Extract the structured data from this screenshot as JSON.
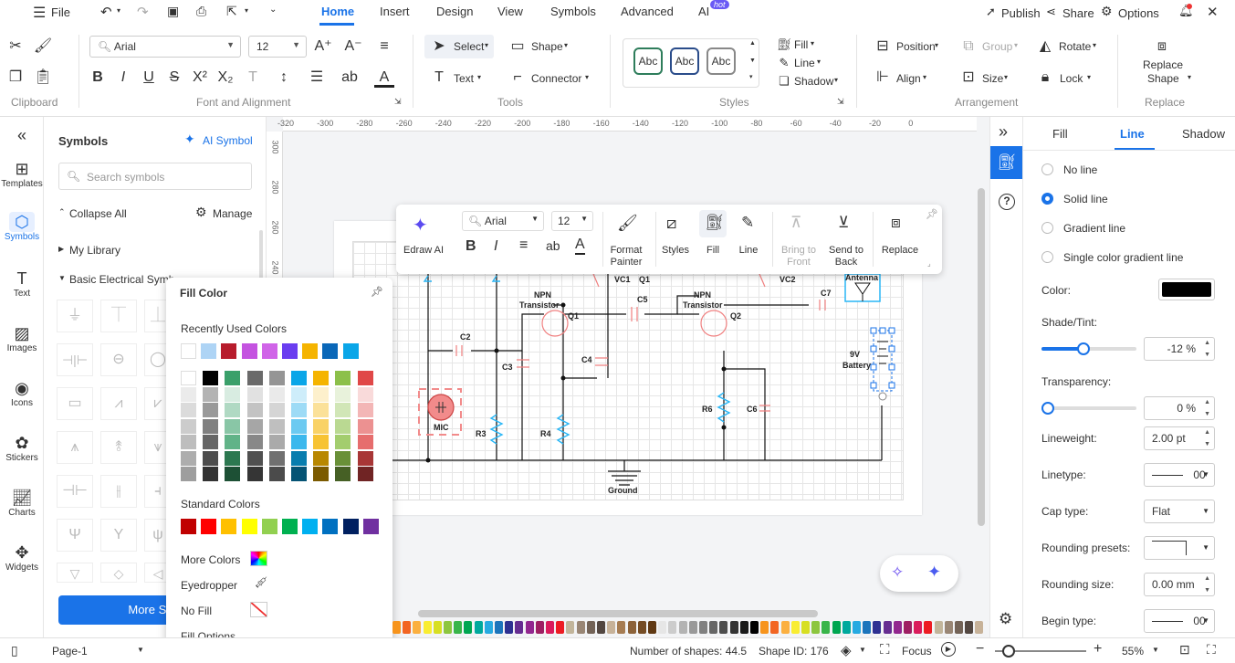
{
  "titlebar": {
    "file_label": "File",
    "tabs": [
      {
        "label": "Home",
        "active": true
      },
      {
        "label": "Insert"
      },
      {
        "label": "Design"
      },
      {
        "label": "View"
      },
      {
        "label": "Symbols"
      },
      {
        "label": "Advanced"
      },
      {
        "label": "AI",
        "badge": "hot"
      }
    ],
    "publish": "Publish",
    "share": "Share",
    "options": "Options"
  },
  "ribbon": {
    "groups": [
      "Clipboard",
      "Font and Alignment",
      "Tools",
      "Styles",
      "Arrangement",
      "Replace"
    ],
    "font_name": "Arial",
    "font_size": "12",
    "select": "Select",
    "shape": "Shape",
    "text": "Text",
    "connector": "Connector",
    "style_sample": "Abc",
    "fill": "Fill",
    "line": "Line",
    "shadow": "Shadow",
    "position": "Position",
    "group": "Group",
    "rotate": "Rotate",
    "align": "Align",
    "size": "Size",
    "lock": "Lock",
    "replace_shape": [
      "Replace",
      "Shape"
    ]
  },
  "leftrail": [
    "Templates",
    "Symbols",
    "Text",
    "Images",
    "Icons",
    "Stickers",
    "Charts",
    "Widgets"
  ],
  "symbols": {
    "title": "Symbols",
    "ai_symbol": "AI Symbol",
    "search_placeholder": "Search symbols",
    "collapse_all": "Collapse All",
    "manage": "Manage",
    "my_library": "My Library",
    "basic_electrical": "Basic Electrical Symb",
    "more_symbols": "More Sym"
  },
  "ruler": {
    "h": [
      "-320",
      "-300",
      "-280",
      "-260",
      "-240",
      "-220",
      "-200",
      "-180",
      "-160",
      "-140",
      "-120",
      "-100",
      "-80",
      "-60",
      "-40",
      "-20",
      "0"
    ],
    "v": [
      "300",
      "280",
      "260",
      "240"
    ]
  },
  "floatbar": {
    "edraw_ai": "Edraw AI",
    "font": "Arial",
    "size": "12",
    "format_painter": [
      "Format",
      "Painter"
    ],
    "styles": "Styles",
    "fill": "Fill",
    "line": "Line",
    "bring_front": [
      "Bring to",
      "Front"
    ],
    "send_back": [
      "Send to",
      "Back"
    ],
    "replace": "Replace"
  },
  "fill_color": {
    "title": "Fill Color",
    "recent_label": "Recently Used Colors",
    "recent": [
      "#ffffff",
      "#aed4f5",
      "#b71c2c",
      "#c453e0",
      "#d064e8",
      "#6a3df0",
      "#f5b400",
      "#0a67b8",
      "#0aa6e8"
    ],
    "theme_top": [
      "#ffffff",
      "#000000",
      "#3aa06a",
      "#6a6a6a",
      "#959595",
      "#0aa6e8",
      "#f5b400",
      "#8cc04a",
      "#e04848"
    ],
    "standard_label": "Standard Colors",
    "standard": [
      "#c00000",
      "#ff0000",
      "#ffc000",
      "#ffff00",
      "#92d050",
      "#00b050",
      "#00b0f0",
      "#0070c0",
      "#002060",
      "#7030a0"
    ],
    "more_colors": "More Colors",
    "eyedropper": "Eyedropper",
    "no_fill": "No Fill",
    "fill_options": "Fill Options..."
  },
  "rightpanel": {
    "tabs": [
      "Fill",
      "Line",
      "Shadow"
    ],
    "active_tab": "Line",
    "radios": [
      "No line",
      "Solid line",
      "Gradient line",
      "Single color gradient line"
    ],
    "selected_radio": "Solid line",
    "color_label": "Color:",
    "color_value": "#000000",
    "shade_label": "Shade/Tint:",
    "shade_value": "-12 %",
    "shade_level": 0.44,
    "transparency_label": "Transparency:",
    "transparency_value": "0 %",
    "transparency_level": 0,
    "lineweight_label": "Lineweight:",
    "lineweight_value": "2.00 pt",
    "linetype_label": "Linetype:",
    "linetype_value": "00",
    "captype_label": "Cap type:",
    "captype_value": "Flat",
    "rounding_presets_label": "Rounding presets:",
    "rounding_size_label": "Rounding size:",
    "rounding_size_value": "0.00 mm",
    "begin_type_label": "Begin type:",
    "begin_type_value": "00"
  },
  "diagram": {
    "labels": [
      "NPN",
      "Transistor",
      "Q1",
      "NPN",
      "Transistor",
      "Q2",
      "VC1",
      "Q1",
      "C5",
      "VC2",
      "C7",
      "C2",
      "C3",
      "C4",
      "R3",
      "R4",
      "R6",
      "C6",
      "MIC",
      "9V",
      "Battery",
      "Ground",
      "Antenna"
    ]
  },
  "status": {
    "page_tab": "Page-1",
    "shapes": "Number of shapes: 44.5",
    "shape_id": "Shape ID: 176",
    "focus": "Focus",
    "zoom": "55%"
  }
}
